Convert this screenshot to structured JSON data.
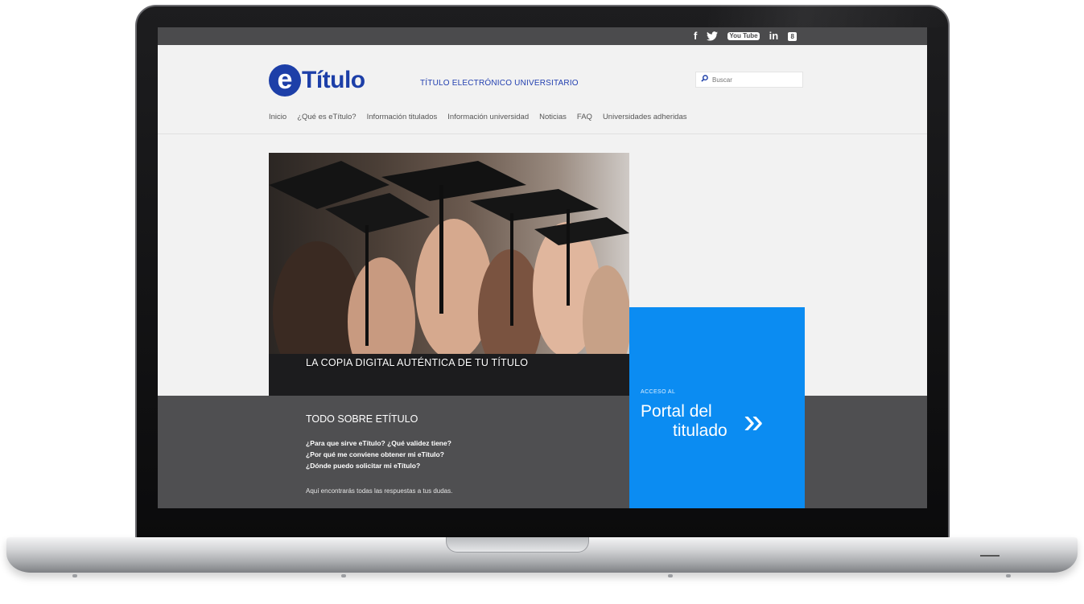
{
  "social": {
    "facebook": "f",
    "twitter": "🐦",
    "youtube": "You Tube",
    "linkedin": "in",
    "other": "8",
    "icons": [
      "facebook-icon",
      "twitter-icon",
      "youtube-icon",
      "linkedin-icon",
      "square-icon"
    ]
  },
  "header": {
    "logo_letter": "e",
    "logo_text": "Título",
    "tagline": "TÍTULO ELECTRÓNICO UNIVERSITARIO",
    "brand_color": "#1d3fa8"
  },
  "search": {
    "placeholder": "Buscar",
    "icon": "search-icon"
  },
  "nav": {
    "items": [
      "Inicio",
      "¿Qué es eTítulo?",
      "Información titulados",
      "Información universidad",
      "Noticias",
      "FAQ",
      "Universidades adheridas"
    ]
  },
  "hero": {
    "caption": "LA COPIA DIGITAL AUTÉNTICA DE TU TÍTULO"
  },
  "about": {
    "title": "TODO SOBRE ETÍTULO",
    "questions": [
      "¿Para que sirve eTítulo? ¿Qué validez tiene?",
      "¿Por qué me conviene obtener mi eTítulo?",
      "¿Dónde puedo solicitar mi eTítulo?"
    ],
    "footer": "Aquí encontrarás todas las respuestas a tus dudas."
  },
  "portal": {
    "small": "ACCESO AL",
    "line1": "Portal del",
    "line2": "titulado",
    "arrow": "»",
    "color": "#0b8cf2"
  }
}
